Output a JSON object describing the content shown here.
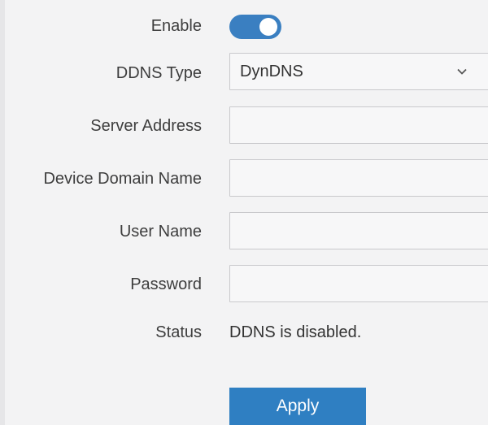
{
  "form": {
    "enable_label": "Enable",
    "enable_on": true,
    "ddns_type_label": "DDNS Type",
    "ddns_type_value": "DynDNS",
    "server_address_label": "Server Address",
    "server_address_value": "",
    "device_domain_label": "Device Domain Name",
    "device_domain_value": "",
    "user_name_label": "User Name",
    "user_name_value": "",
    "password_label": "Password",
    "password_value": "",
    "status_label": "Status",
    "status_value": "DDNS is disabled."
  },
  "actions": {
    "apply_label": "Apply"
  },
  "colors": {
    "accent": "#3a7fc1",
    "button": "#2f7fc2",
    "background": "#f3f3f4"
  },
  "icons": {
    "select_arrow": "chevron-down-icon"
  }
}
